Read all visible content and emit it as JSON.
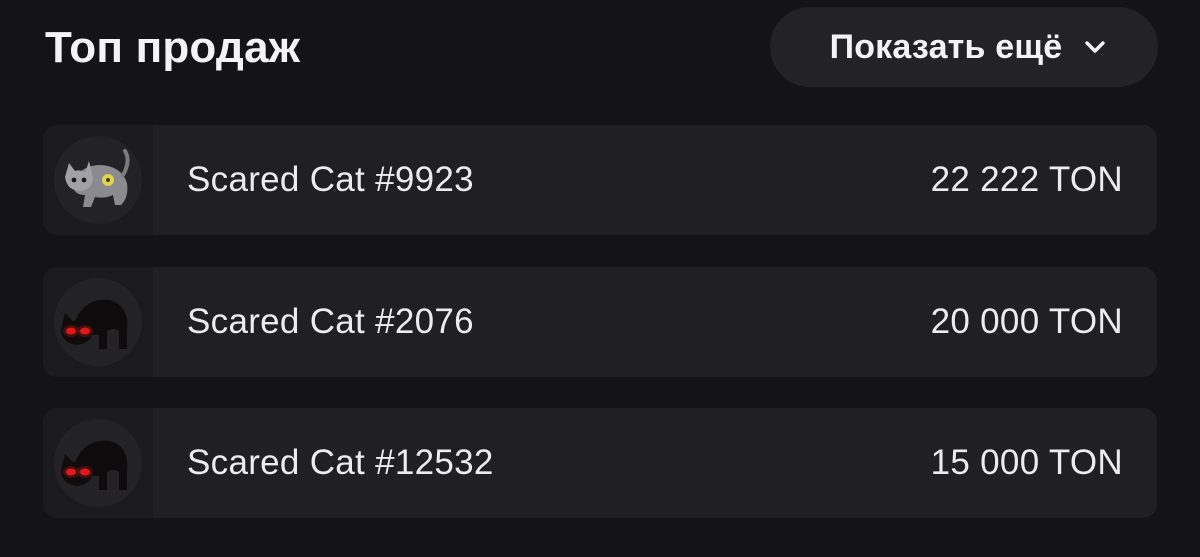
{
  "header": {
    "title": "Топ продаж",
    "more_label": "Показать ещё"
  },
  "items": [
    {
      "name": "Scared Cat #9923",
      "price": "22 222 TON",
      "thumb_icon": "gray-cat-icon"
    },
    {
      "name": "Scared Cat #2076",
      "price": "20 000 TON",
      "thumb_icon": "black-cat-red-eyes-icon"
    },
    {
      "name": "Scared Cat #12532",
      "price": "15 000 TON",
      "thumb_icon": "black-cat-red-eyes-icon"
    }
  ],
  "colors": {
    "background": "#141416",
    "row_background": "#202023",
    "button_background": "#232326",
    "text": "#ececee",
    "cat_eye_red": "#e01818"
  }
}
